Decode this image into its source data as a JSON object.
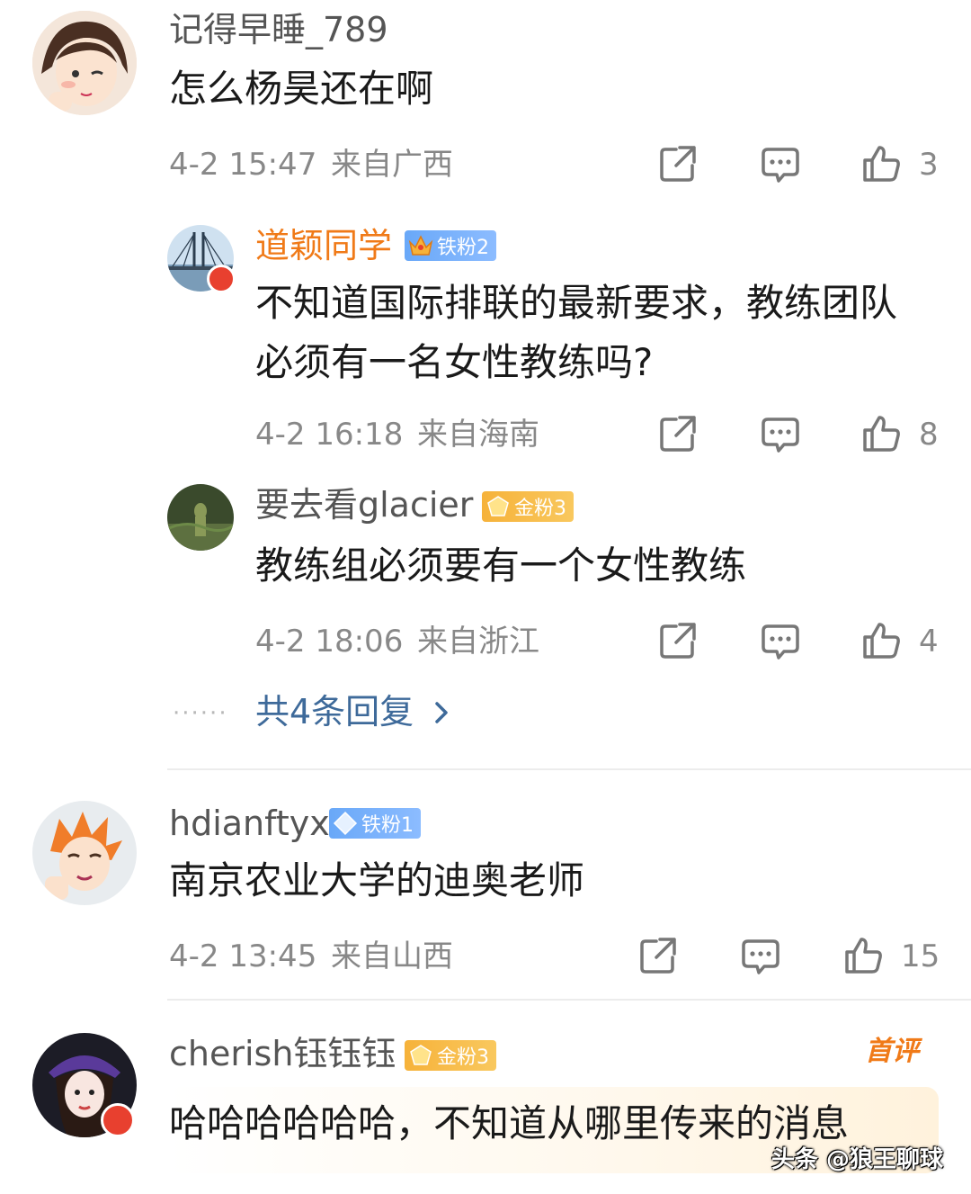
{
  "comments": [
    {
      "username": "记得早睡_789",
      "text": "怎么杨昊还在啊",
      "time": "4-2 15:47",
      "location": "来自广西",
      "likes": "3",
      "replies": [
        {
          "username": "道颖同学",
          "badge": "铁粉2",
          "text": "不知道国际排联的最新要求，教练团队必须有一名女性教练吗?",
          "time": "4-2 16:18",
          "location": "来自海南",
          "likes": "8"
        },
        {
          "username": "要去看glacier",
          "badge": "金粉3",
          "text": "教练组必须要有一个女性教练",
          "time": "4-2 18:06",
          "location": "来自浙江",
          "likes": "4"
        }
      ],
      "more_replies": "共4条回复"
    },
    {
      "username": "hdianftyx",
      "badge": "铁粉1",
      "text": "南京农业大学的迪奥老师",
      "time": "4-2 13:45",
      "location": "来自山西",
      "likes": "15"
    },
    {
      "username": "cherish钰钰钰",
      "badge": "金粉3",
      "tag": "首评",
      "text": "哈哈哈哈哈哈，不知道从哪里传来的消息"
    }
  ],
  "watermark": "头条 @狼王聊球",
  "colors": {
    "accent_username": "#f07a18",
    "link": "#3e6a9a",
    "meta": "#888888",
    "badge_iron": "#69a8f8",
    "badge_gold": "#f6b23a",
    "first_comment_tag": "#f07a18"
  },
  "icons": [
    "share-icon",
    "comment-icon",
    "like-icon",
    "chevron-right-icon",
    "crown-icon",
    "diamond-icon",
    "gem-icon"
  ]
}
